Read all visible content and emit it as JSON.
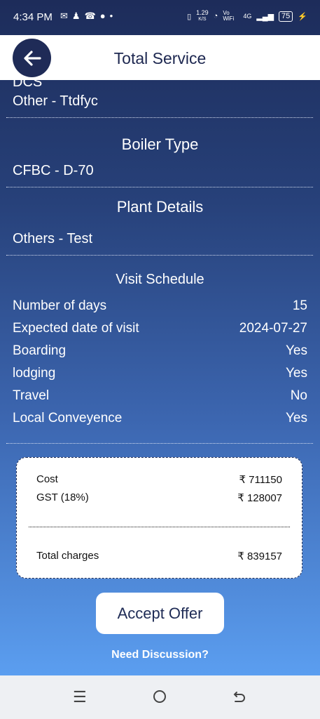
{
  "status_bar": {
    "time": "4:34 PM",
    "left_icons": [
      "mail-icon",
      "person-icon",
      "missed-call-icon",
      "chat-icon",
      "dot-icon"
    ],
    "speed": "1.29",
    "speed_unit": "K/S",
    "volte": "Vo WiFi",
    "network": "4G",
    "battery": "75"
  },
  "header": {
    "title": "Total Service",
    "back_icon": "arrow-left-icon"
  },
  "sections": {
    "dcs_cut_label": "DCS",
    "dcs_value": "Other - Ttdfyc",
    "boiler_title": "Boiler Type",
    "boiler_value": "CFBC - D-70",
    "plant_title": "Plant Details",
    "plant_value": "Others - Test",
    "visit_title": "Visit Schedule"
  },
  "visit_schedule": [
    {
      "label": "Number of days",
      "value": "15"
    },
    {
      "label": "Expected date of visit",
      "value": "2024-07-27"
    },
    {
      "label": "Boarding",
      "value": "Yes"
    },
    {
      "label": "lodging",
      "value": "Yes"
    },
    {
      "label": "Travel",
      "value": "No"
    },
    {
      "label": "Local Conveyence",
      "value": "Yes"
    }
  ],
  "charges": {
    "cost_label": "Cost",
    "cost_value": "₹ 711150",
    "gst_label": "GST (18%)",
    "gst_value": "₹ 128007",
    "total_label": "Total charges",
    "total_value": "₹ 839157"
  },
  "actions": {
    "accept_label": "Accept Offer",
    "discussion_label": "Need Discussion?"
  },
  "colors": {
    "header_bg": "#ffffff",
    "primary_dark": "#1f2b57",
    "gradient_top": "#1d2c5a",
    "gradient_bottom": "#5b9ef0"
  },
  "nav_icons": [
    "menu-icon",
    "home-circle-icon",
    "back-icon"
  ]
}
